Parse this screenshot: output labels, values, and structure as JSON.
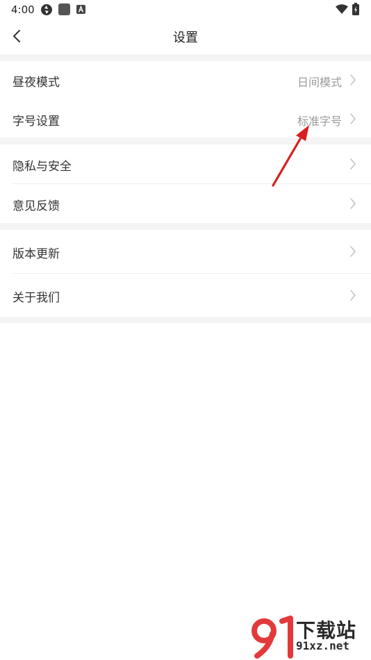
{
  "status_bar": {
    "time": "4:00",
    "icons": [
      "vpn-icon",
      "app-square-icon",
      "keyboard-a-icon",
      "wifi-icon",
      "battery-icon"
    ]
  },
  "header": {
    "title": "设置",
    "back_icon": "chevron-left-icon"
  },
  "settings": {
    "group1": {
      "day_night": {
        "label": "昼夜模式",
        "value": "日间模式"
      },
      "font_size": {
        "label": "字号设置",
        "value": "标准字号"
      }
    },
    "group2": {
      "privacy": {
        "label": "隐私与安全"
      },
      "feedback": {
        "label": "意见反馈"
      }
    },
    "group3": {
      "update": {
        "label": "版本更新"
      },
      "about": {
        "label": "关于我们"
      }
    }
  },
  "annotation": {
    "color": "#d81e1e",
    "icon": "red-arrow-icon"
  },
  "watermark": {
    "logo_icon": "91-logo-icon",
    "text_cn": "下载站",
    "text_url": "91xz.net",
    "logo_color": "#e23a3a"
  },
  "colors": {
    "background": "#ffffff",
    "divider": "#f4f4f4",
    "value_text": "#9a9a9a",
    "label_text": "#333333"
  }
}
